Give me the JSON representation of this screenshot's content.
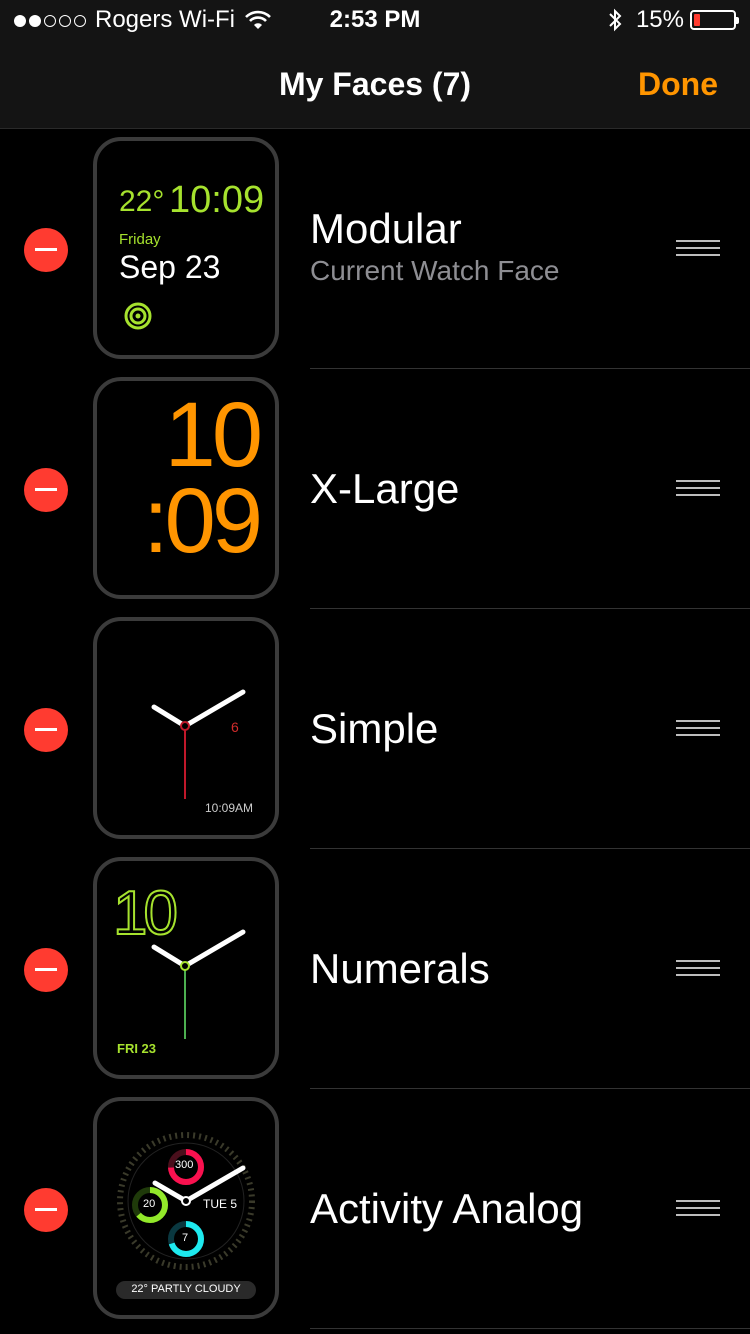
{
  "status": {
    "carrier": "Rogers Wi-Fi",
    "time": "2:53 PM",
    "battery": "15%",
    "signal_bars": 2,
    "signal_total": 5,
    "battery_level": 0.15
  },
  "nav": {
    "title": "My Faces (7)",
    "done": "Done"
  },
  "colors": {
    "accent": "#ff9500",
    "delete": "#ff3b30",
    "lime": "#a6e22e",
    "orange": "#ff9500"
  },
  "faces": [
    {
      "name": "Modular",
      "subtitle": "Current Watch Face",
      "preview": {
        "temp": "22°",
        "time": "10:09",
        "day": "Friday",
        "date": "Sep 23"
      }
    },
    {
      "name": "X-Large",
      "preview": {
        "hour": "10",
        "minute": ":09"
      }
    },
    {
      "name": "Simple",
      "preview": {
        "seconds_number": "6",
        "time": "10:09AM"
      }
    },
    {
      "name": "Numerals",
      "preview": {
        "number": "10",
        "date": "FRI 23"
      }
    },
    {
      "name": "Activity Analog",
      "preview": {
        "move": "300",
        "exercise": "20",
        "stand": "7",
        "date": "TUE 5",
        "weather": "22° PARTLY CLOUDY"
      }
    }
  ],
  "icons": [
    "wifi-icon",
    "bluetooth-icon",
    "battery-icon",
    "delete-icon",
    "reorder-icon",
    "activity-rings-icon"
  ]
}
